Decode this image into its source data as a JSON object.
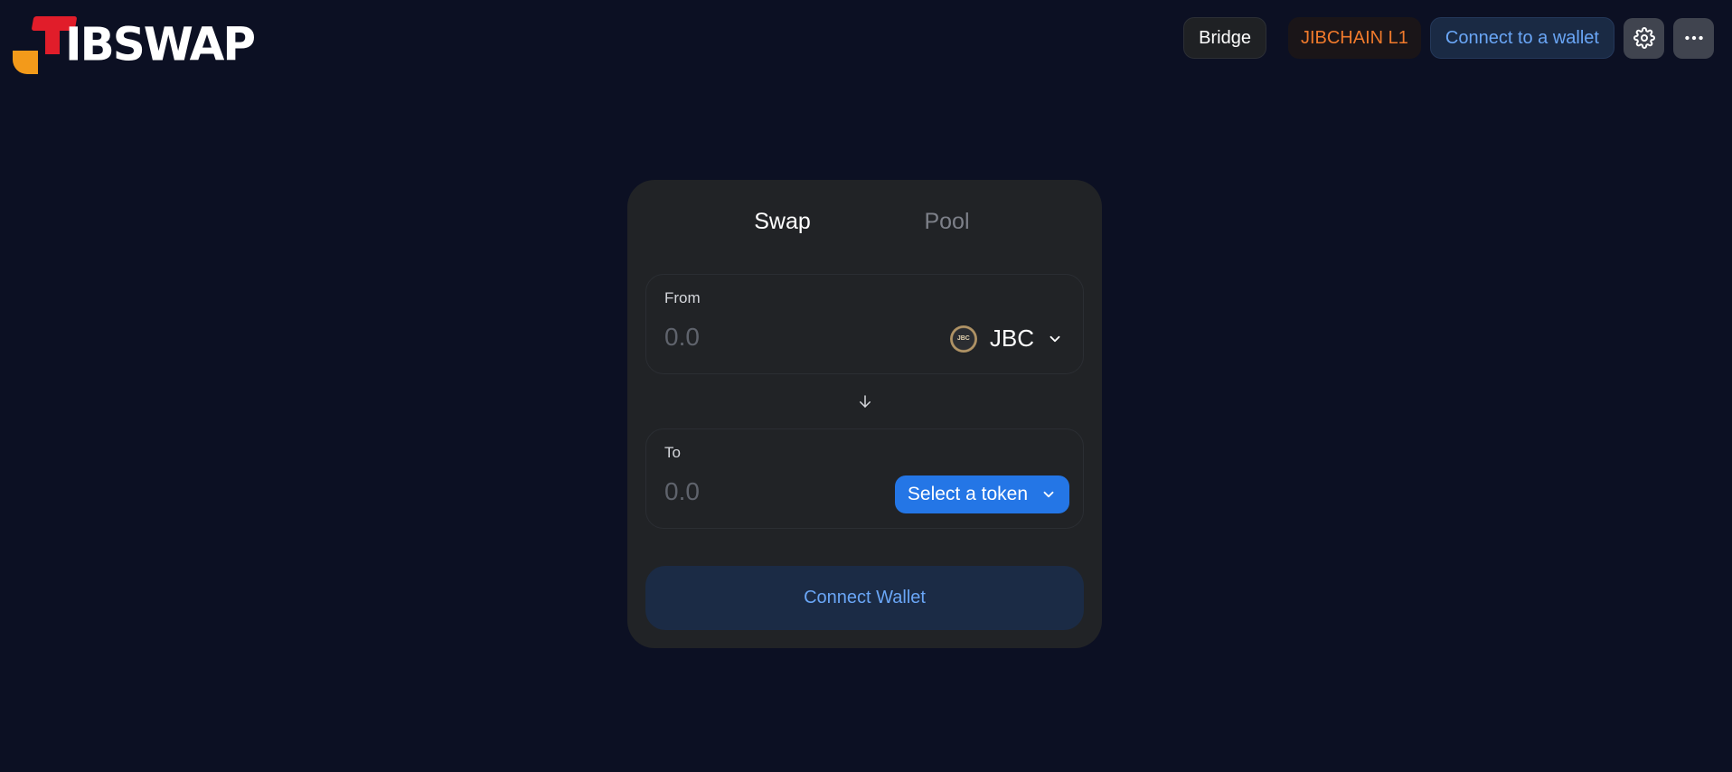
{
  "header": {
    "logo_text": "IBSWAP",
    "bridge_label": "Bridge",
    "chain_label": "JIBCHAIN L1",
    "connect_label": "Connect to a wallet",
    "settings_icon": "gear-icon",
    "more_icon": "more-horizontal-icon"
  },
  "swap": {
    "tabs": [
      {
        "label": "Swap",
        "active": true
      },
      {
        "label": "Pool",
        "active": false
      }
    ],
    "from": {
      "label": "From",
      "placeholder": "0.0",
      "token_symbol": "JBC",
      "token_logo_text": "JBC"
    },
    "to": {
      "label": "To",
      "placeholder": "0.0",
      "select_label": "Select a token"
    },
    "connect_button_label": "Connect Wallet"
  },
  "colors": {
    "background": "#0c1023",
    "card": "#212326",
    "accent_blue": "#2476e6",
    "connect_text": "#6aa6f6",
    "chain_orange": "#f07a2c",
    "logo_red": "#e11d2a",
    "logo_orange": "#f59e0b"
  }
}
